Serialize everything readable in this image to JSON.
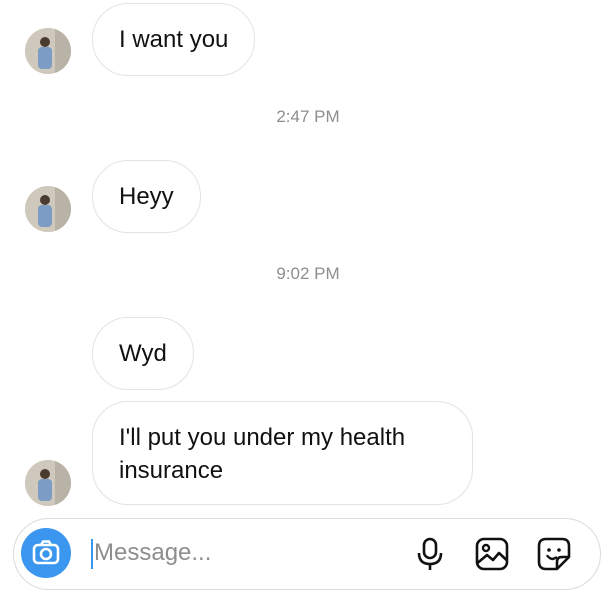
{
  "conversation": {
    "messages": [
      {
        "text": "I want you"
      },
      {
        "text": "Heyy"
      },
      {
        "text": "Wyd"
      },
      {
        "text": "I'll put you under my health insurance"
      }
    ],
    "timestamps": [
      "2:47 PM",
      "9:02 PM"
    ]
  },
  "composer": {
    "placeholder": "Message...",
    "value": "",
    "icons": [
      "camera-icon",
      "microphone-icon",
      "gallery-icon",
      "sticker-icon"
    ],
    "accent_color": "#3b96f0"
  }
}
